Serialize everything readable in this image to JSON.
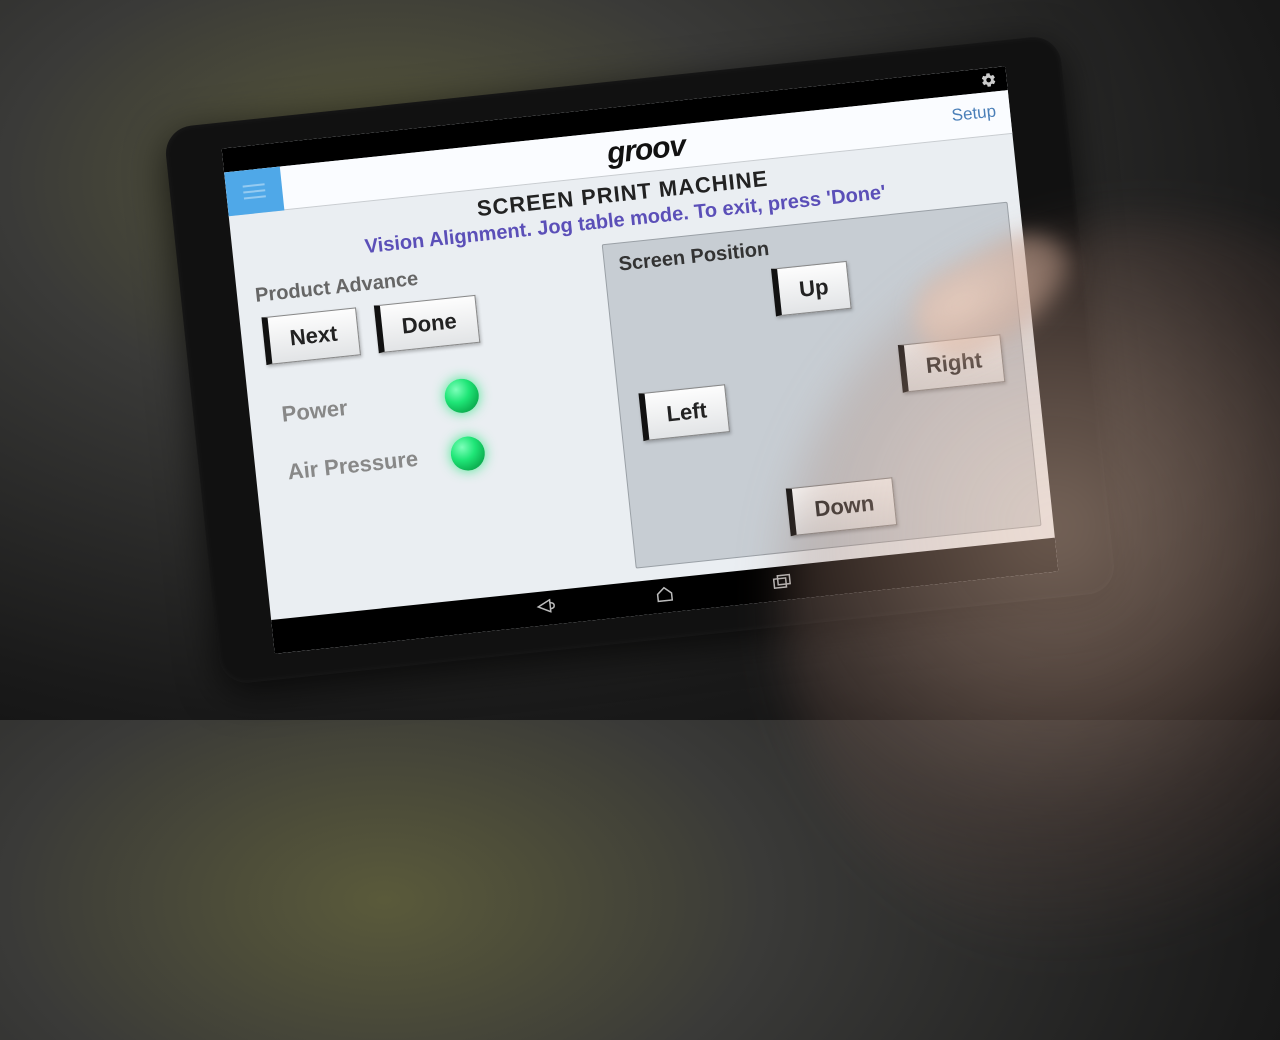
{
  "app": {
    "logo_text": "groov",
    "setup_label": "Setup",
    "machine_title": "SCREEN PRINT MACHINE",
    "mode_line": "Vision Alignment. Jog table mode. To exit, press 'Done'"
  },
  "product_advance": {
    "label": "Product Advance",
    "next_label": "Next",
    "done_label": "Done"
  },
  "status": {
    "power_label": "Power",
    "air_label": "Air Pressure",
    "power_on": true,
    "air_on": true
  },
  "screen_position": {
    "label": "Screen Position",
    "up_label": "Up",
    "down_label": "Down",
    "left_label": "Left",
    "right_label": "Right"
  },
  "colors": {
    "accent_purple": "#5b4fb8",
    "led_green": "#1fe677",
    "top_blue": "#4fa8e8"
  }
}
